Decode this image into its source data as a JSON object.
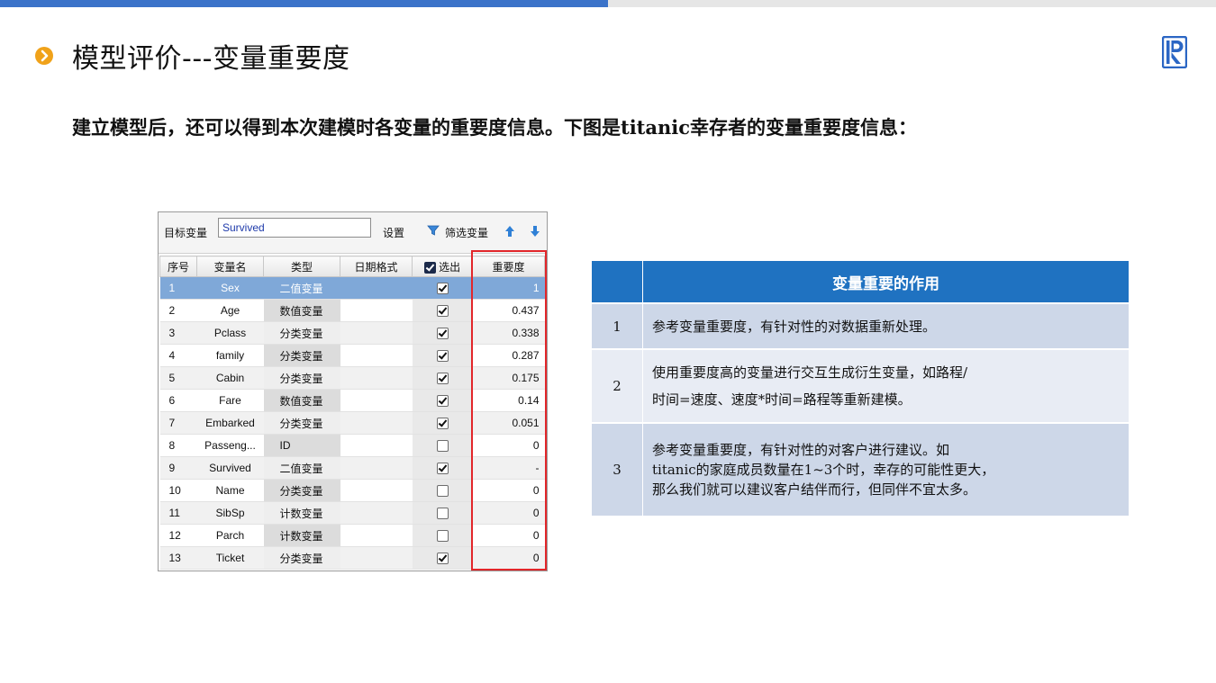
{
  "header": {
    "title": "模型评价---变量重要度",
    "subtitle": "建立模型后，还可以得到本次建模时各变量的重要度信息。下图是titanic幸存者的变量重要度信息："
  },
  "colors": {
    "accent": "#3b73c9",
    "title_icon": "#f0a21a",
    "table_header": "#1f72c1",
    "highlight_box": "#e2262a",
    "selected_row": "#7fa8d8"
  },
  "panel": {
    "target_label": "目标变量",
    "target_value": "Survived",
    "settings_label": "设置",
    "filter_label": "筛选变量",
    "columns": [
      "序号",
      "变量名",
      "类型",
      "日期格式",
      "选出",
      "重要度"
    ],
    "rows": [
      {
        "no": "1",
        "name": "Sex",
        "type": "二值变量",
        "date": "",
        "selected": true,
        "importance": "1"
      },
      {
        "no": "2",
        "name": "Age",
        "type": "数值变量",
        "date": "",
        "selected": true,
        "importance": "0.437"
      },
      {
        "no": "3",
        "name": "Pclass",
        "type": "分类变量",
        "date": "",
        "selected": true,
        "importance": "0.338"
      },
      {
        "no": "4",
        "name": "family",
        "type": "分类变量",
        "date": "",
        "selected": true,
        "importance": "0.287"
      },
      {
        "no": "5",
        "name": "Cabin",
        "type": "分类变量",
        "date": "",
        "selected": true,
        "importance": "0.175"
      },
      {
        "no": "6",
        "name": "Fare",
        "type": "数值变量",
        "date": "",
        "selected": true,
        "importance": "0.14"
      },
      {
        "no": "7",
        "name": "Embarked",
        "type": "分类变量",
        "date": "",
        "selected": true,
        "importance": "0.051"
      },
      {
        "no": "8",
        "name": "Passeng...",
        "type": "ID",
        "date": "",
        "selected": false,
        "importance": "0"
      },
      {
        "no": "9",
        "name": "Survived",
        "type": "二值变量",
        "date": "",
        "selected": true,
        "importance": "-"
      },
      {
        "no": "10",
        "name": "Name",
        "type": "分类变量",
        "date": "",
        "selected": false,
        "importance": "0"
      },
      {
        "no": "11",
        "name": "SibSp",
        "type": "计数变量",
        "date": "",
        "selected": false,
        "importance": "0"
      },
      {
        "no": "12",
        "name": "Parch",
        "type": "计数变量",
        "date": "",
        "selected": false,
        "importance": "0"
      },
      {
        "no": "13",
        "name": "Ticket",
        "type": "分类变量",
        "date": "",
        "selected": true,
        "importance": "0"
      }
    ],
    "selected_row_index": 0
  },
  "info_table": {
    "header": "变量重要的作用",
    "rows": [
      {
        "num": "1",
        "lines": [
          "参考变量重要度，有针对性的对数据重新处理。"
        ]
      },
      {
        "num": "2",
        "lines": [
          "使用重要度高的变量进行交互生成衍生变量，如路程/",
          "时间=速度、速度*时间=路程等重新建模。"
        ]
      },
      {
        "num": "3",
        "lines": [
          "参考变量重要度，有针对性的对客户进行建议。如",
          "titanic的家庭成员数量在1~3个时，幸存的可能性更大，",
          "那么我们就可以建议客户结伴而行，但同伴不宜太多。"
        ]
      }
    ]
  }
}
